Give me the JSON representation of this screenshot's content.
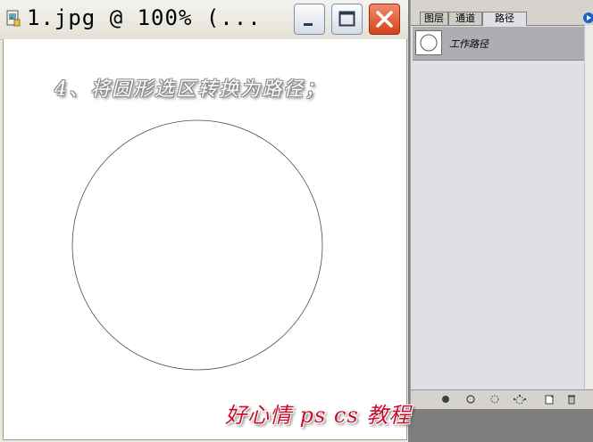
{
  "document": {
    "title": "1.jpg @ 100% (...",
    "caption": "4、将圆形选区转换为路径；"
  },
  "window_controls": {
    "minimize_icon": "minimize-icon",
    "maximize_icon": "maximize-icon",
    "close_icon": "close-icon"
  },
  "panel": {
    "tabs": [
      {
        "label": "图层"
      },
      {
        "label": "通道"
      },
      {
        "label": "路径"
      }
    ],
    "active_tab": "路径",
    "paths": [
      {
        "label": "工作路径"
      }
    ],
    "footer_icons": [
      "fill-path-icon",
      "stroke-path-icon",
      "load-selection-icon",
      "make-work-path-icon",
      "new-path-icon",
      "delete-path-icon"
    ]
  },
  "watermark": "好心情 ps cs 教程",
  "colors": {
    "close_button": "#d6401b",
    "watermark": "#c8102e",
    "panel_bg": "#e0dfe3"
  }
}
